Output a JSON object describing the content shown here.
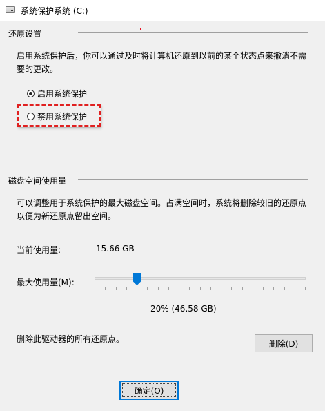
{
  "window": {
    "title": "系统保护系统 (C:)"
  },
  "restore_settings": {
    "section_label": "还原设置",
    "description": "启用系统保护后，你可以通过及时将计算机还原到以前的某个状态点来撤消不需要的更改。",
    "options": [
      {
        "label": "启用系统保护",
        "checked": true
      },
      {
        "label": "禁用系统保护",
        "checked": false
      }
    ]
  },
  "disk_usage": {
    "section_label": "磁盘空间使用量",
    "description": "可以调整用于系统保护的最大磁盘空间。占满空间时，系统将删除较旧的还原点以便为新还原点留出空间。",
    "current_label": "当前使用量:",
    "current_value": "15.66 GB",
    "max_label": "最大使用量(M):",
    "slider_percent": 20,
    "percent_text": "20% (46.58 GB)",
    "delete_text": "删除此驱动器的所有还原点。",
    "delete_button": "删除(D)"
  },
  "footer": {
    "ok_button": "确定(O)"
  },
  "colors": {
    "accent": "#0078d7",
    "highlight": "#e02020"
  }
}
